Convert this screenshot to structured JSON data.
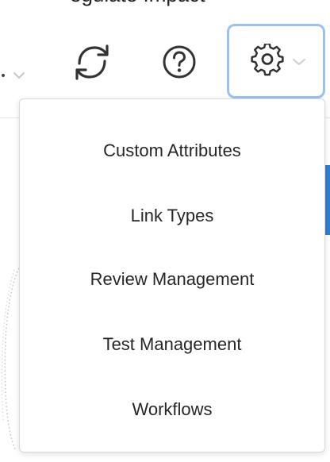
{
  "top_text": "egulate Impact",
  "toolbar": {
    "caret_icon": "chevron-down-icon",
    "sync_icon": "sync-icon",
    "help_icon": "help-icon",
    "settings_icon": "gear-icon",
    "settings_caret_icon": "chevron-down-icon"
  },
  "colors": {
    "focus_border": "#9bc1f0",
    "accent": "#2f7fd4",
    "menu_text": "#262626",
    "icon": "#333333"
  },
  "menu": {
    "items": [
      {
        "label": "Custom Attributes"
      },
      {
        "label": "Link Types"
      },
      {
        "label": "Review Management"
      },
      {
        "label": "Test Management"
      },
      {
        "label": "Workflows"
      }
    ]
  }
}
